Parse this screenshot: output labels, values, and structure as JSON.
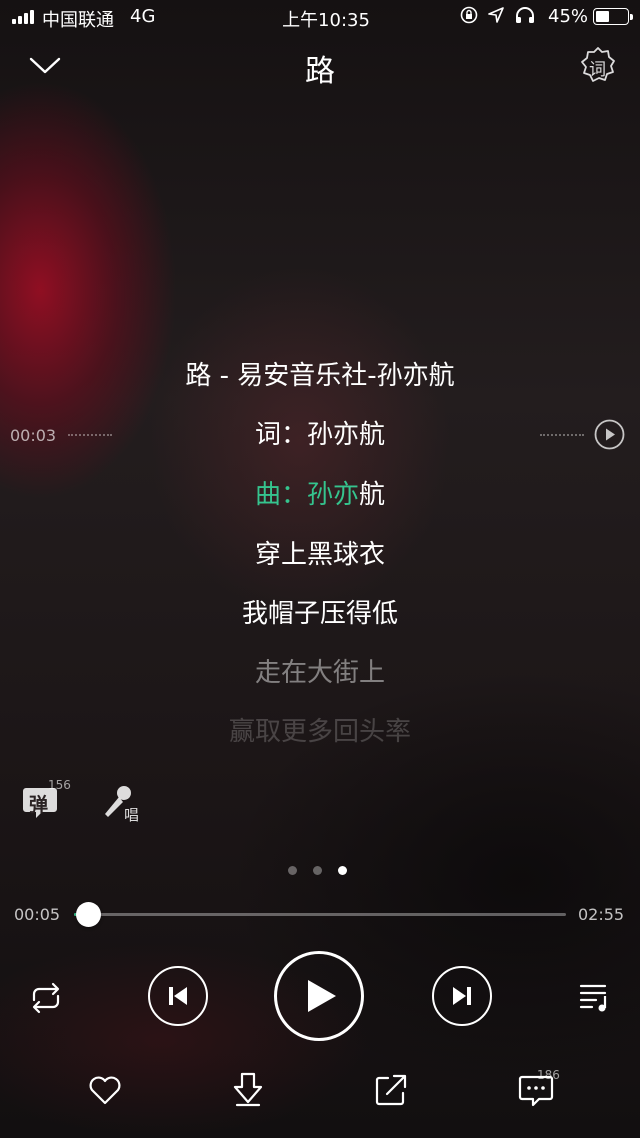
{
  "status_bar": {
    "carrier": "中国联通",
    "network": "4G",
    "time": "上午10:35",
    "battery_percent_label": "45%",
    "battery_level": 0.45
  },
  "header": {
    "song_title": "路",
    "lyric_settings_glyph": "词",
    "icons": [
      "chevron-down-icon",
      "lyric-settings-icon"
    ]
  },
  "lyrics": {
    "lines": [
      {
        "text": "路 - 易安音乐社-孙亦航",
        "state": "normal"
      },
      {
        "text": "词：孙亦航",
        "state": "normal"
      },
      {
        "highlight_text": "曲：孙亦",
        "rest_text": "航",
        "state": "current"
      },
      {
        "text": "穿上黑球衣",
        "state": "normal"
      },
      {
        "text": "我帽子压得低",
        "state": "normal"
      },
      {
        "text": "走在大街上",
        "state": "dim"
      },
      {
        "text": "赢取更多回头率",
        "state": "dimmer"
      }
    ],
    "seek_preview_time": "00:03"
  },
  "actions": {
    "danmu_label": "弹",
    "danmu_count": "156",
    "sing_label": "唱"
  },
  "pager": {
    "pages": 3,
    "active_index": 2
  },
  "progress": {
    "current_time": "00:05",
    "total_time": "02:55",
    "fraction": 0.029,
    "accent_color": "#35c48e"
  },
  "controls": [
    "repeat-icon",
    "previous-icon",
    "play-icon",
    "next-icon",
    "playlist-icon"
  ],
  "bottom_actions": {
    "icons": [
      "heart-icon",
      "download-icon",
      "share-icon",
      "comment-icon"
    ],
    "comment_count": "186"
  }
}
